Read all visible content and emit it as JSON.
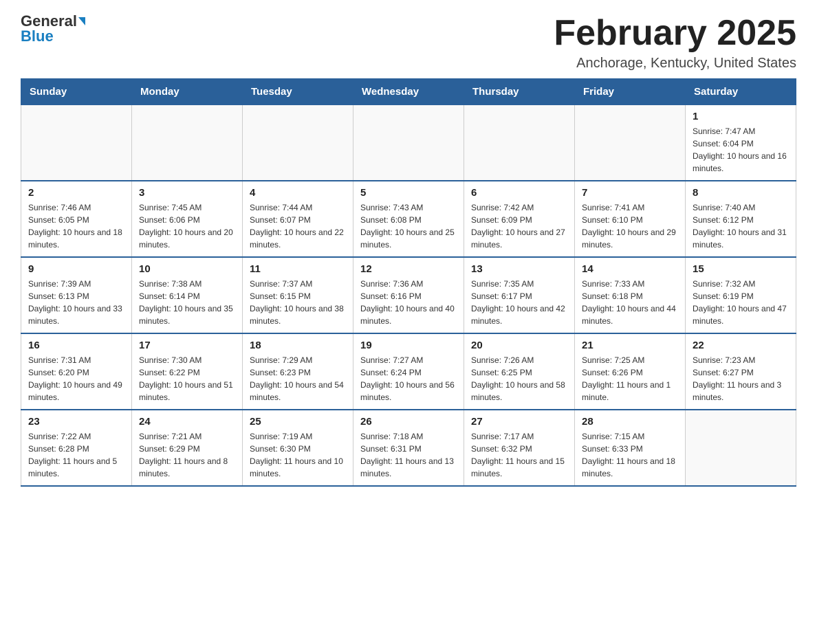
{
  "header": {
    "logo_general": "General",
    "logo_blue": "Blue",
    "month_title": "February 2025",
    "location": "Anchorage, Kentucky, United States"
  },
  "weekdays": [
    "Sunday",
    "Monday",
    "Tuesday",
    "Wednesday",
    "Thursday",
    "Friday",
    "Saturday"
  ],
  "weeks": [
    [
      {
        "day": "",
        "info": ""
      },
      {
        "day": "",
        "info": ""
      },
      {
        "day": "",
        "info": ""
      },
      {
        "day": "",
        "info": ""
      },
      {
        "day": "",
        "info": ""
      },
      {
        "day": "",
        "info": ""
      },
      {
        "day": "1",
        "info": "Sunrise: 7:47 AM\nSunset: 6:04 PM\nDaylight: 10 hours and 16 minutes."
      }
    ],
    [
      {
        "day": "2",
        "info": "Sunrise: 7:46 AM\nSunset: 6:05 PM\nDaylight: 10 hours and 18 minutes."
      },
      {
        "day": "3",
        "info": "Sunrise: 7:45 AM\nSunset: 6:06 PM\nDaylight: 10 hours and 20 minutes."
      },
      {
        "day": "4",
        "info": "Sunrise: 7:44 AM\nSunset: 6:07 PM\nDaylight: 10 hours and 22 minutes."
      },
      {
        "day": "5",
        "info": "Sunrise: 7:43 AM\nSunset: 6:08 PM\nDaylight: 10 hours and 25 minutes."
      },
      {
        "day": "6",
        "info": "Sunrise: 7:42 AM\nSunset: 6:09 PM\nDaylight: 10 hours and 27 minutes."
      },
      {
        "day": "7",
        "info": "Sunrise: 7:41 AM\nSunset: 6:10 PM\nDaylight: 10 hours and 29 minutes."
      },
      {
        "day": "8",
        "info": "Sunrise: 7:40 AM\nSunset: 6:12 PM\nDaylight: 10 hours and 31 minutes."
      }
    ],
    [
      {
        "day": "9",
        "info": "Sunrise: 7:39 AM\nSunset: 6:13 PM\nDaylight: 10 hours and 33 minutes."
      },
      {
        "day": "10",
        "info": "Sunrise: 7:38 AM\nSunset: 6:14 PM\nDaylight: 10 hours and 35 minutes."
      },
      {
        "day": "11",
        "info": "Sunrise: 7:37 AM\nSunset: 6:15 PM\nDaylight: 10 hours and 38 minutes."
      },
      {
        "day": "12",
        "info": "Sunrise: 7:36 AM\nSunset: 6:16 PM\nDaylight: 10 hours and 40 minutes."
      },
      {
        "day": "13",
        "info": "Sunrise: 7:35 AM\nSunset: 6:17 PM\nDaylight: 10 hours and 42 minutes."
      },
      {
        "day": "14",
        "info": "Sunrise: 7:33 AM\nSunset: 6:18 PM\nDaylight: 10 hours and 44 minutes."
      },
      {
        "day": "15",
        "info": "Sunrise: 7:32 AM\nSunset: 6:19 PM\nDaylight: 10 hours and 47 minutes."
      }
    ],
    [
      {
        "day": "16",
        "info": "Sunrise: 7:31 AM\nSunset: 6:20 PM\nDaylight: 10 hours and 49 minutes."
      },
      {
        "day": "17",
        "info": "Sunrise: 7:30 AM\nSunset: 6:22 PM\nDaylight: 10 hours and 51 minutes."
      },
      {
        "day": "18",
        "info": "Sunrise: 7:29 AM\nSunset: 6:23 PM\nDaylight: 10 hours and 54 minutes."
      },
      {
        "day": "19",
        "info": "Sunrise: 7:27 AM\nSunset: 6:24 PM\nDaylight: 10 hours and 56 minutes."
      },
      {
        "day": "20",
        "info": "Sunrise: 7:26 AM\nSunset: 6:25 PM\nDaylight: 10 hours and 58 minutes."
      },
      {
        "day": "21",
        "info": "Sunrise: 7:25 AM\nSunset: 6:26 PM\nDaylight: 11 hours and 1 minute."
      },
      {
        "day": "22",
        "info": "Sunrise: 7:23 AM\nSunset: 6:27 PM\nDaylight: 11 hours and 3 minutes."
      }
    ],
    [
      {
        "day": "23",
        "info": "Sunrise: 7:22 AM\nSunset: 6:28 PM\nDaylight: 11 hours and 5 minutes."
      },
      {
        "day": "24",
        "info": "Sunrise: 7:21 AM\nSunset: 6:29 PM\nDaylight: 11 hours and 8 minutes."
      },
      {
        "day": "25",
        "info": "Sunrise: 7:19 AM\nSunset: 6:30 PM\nDaylight: 11 hours and 10 minutes."
      },
      {
        "day": "26",
        "info": "Sunrise: 7:18 AM\nSunset: 6:31 PM\nDaylight: 11 hours and 13 minutes."
      },
      {
        "day": "27",
        "info": "Sunrise: 7:17 AM\nSunset: 6:32 PM\nDaylight: 11 hours and 15 minutes."
      },
      {
        "day": "28",
        "info": "Sunrise: 7:15 AM\nSunset: 6:33 PM\nDaylight: 11 hours and 18 minutes."
      },
      {
        "day": "",
        "info": ""
      }
    ]
  ]
}
